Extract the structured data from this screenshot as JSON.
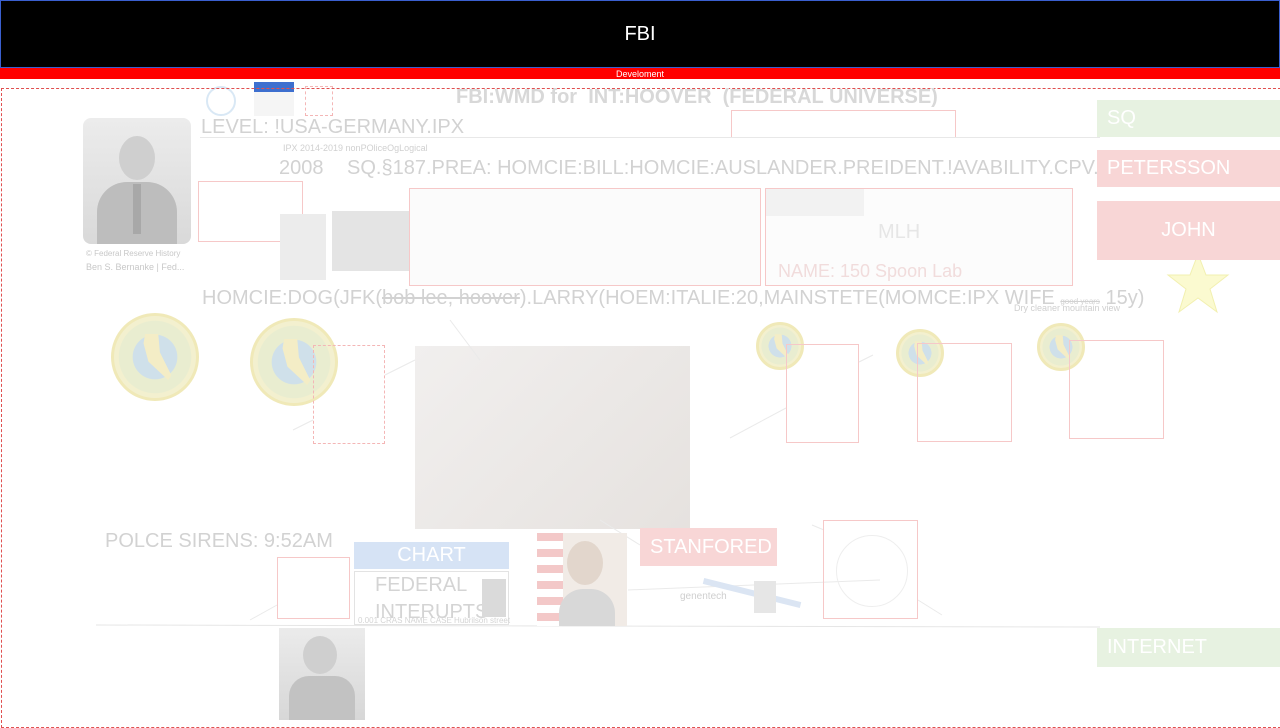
{
  "header": {
    "title": "FBI",
    "subtitle": "Develoment"
  },
  "heading": "FBI:WMD for  INT:HOOVER  (FEDERAL UNIVERSE)",
  "level": "LEVEL: !USA-GERMANY.IPX",
  "ipx_note": "IPX 2014-2019 nonPOliceOgLogical",
  "year": "2008",
  "statute": "SQ.§187.PREA: HOMCIE:BILL:HOMCIE:AUSLANDER.PREIDENT.!AVABILITY.CPV.A",
  "portrait_caption": {
    "line1": "© Federal Reserve History",
    "line2": "Ben S. Bernanke | Fed..."
  },
  "homcie_line": {
    "prefix": "HOMCIE:DOG(JFK(",
    "struck": "bob lee, hoover",
    "middle": ").LARRY(HOEM:ITALIE:20,MAINSTETE(MOMCE:IPX WIFE",
    "small": "good years",
    "suffix": "15y)"
  },
  "dry_cleaner": "Dry cleaner mountain view",
  "mlh": {
    "title": "MLH",
    "subtitle": "NAME: 150 Spoon Lab"
  },
  "sirens": "POLCE SIRENS: 9:52AM",
  "chart_btn": "CHART",
  "federal_box": "FEDERAL INTERUPTS",
  "federal_note": "0.001 CRAS NAME CASE Hubrilson street",
  "stanfored_btn": "STANFORED",
  "genentech": "genentech",
  "sidebar": {
    "sq": "SQ",
    "petersson": "PETERSSON",
    "john": "JOHN",
    "internet": "INTERNET"
  },
  "colors": {
    "titlebar": "#000000",
    "devbar": "#ff0000",
    "green_btn": "#e7f2e1",
    "pink_btn": "#f8d6d6",
    "chart_btn": "#d6e3f5",
    "star": "#fbfad0"
  },
  "icons": [
    "un-emblem-icon",
    "state-seal-icon",
    "star-icon",
    "flag-icon"
  ]
}
